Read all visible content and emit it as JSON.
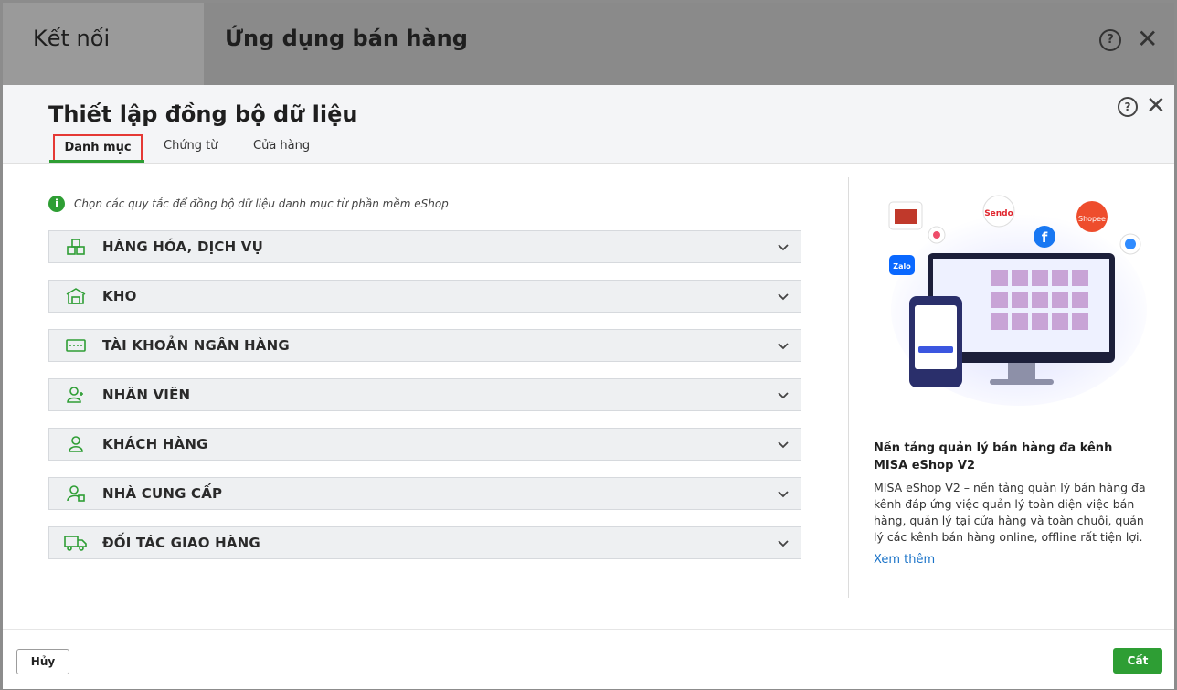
{
  "background": {
    "left_tab_label": "Kết nối",
    "title": "Ứng dụng bán hàng"
  },
  "dialog": {
    "title": "Thiết lập đồng bộ dữ liệu",
    "tabs": [
      {
        "label": "Danh mục",
        "active": true
      },
      {
        "label": "Chứng từ",
        "active": false
      },
      {
        "label": "Cửa hàng",
        "active": false
      }
    ],
    "info_text": "Chọn các quy tắc để đồng bộ dữ liệu danh mục từ phần mềm eShop",
    "sections": [
      {
        "label": "HÀNG HÓA, DỊCH VỤ",
        "icon": "boxes-icon"
      },
      {
        "label": "KHO",
        "icon": "warehouse-icon"
      },
      {
        "label": "TÀI KHOẢN NGÂN HÀNG",
        "icon": "bank-card-icon"
      },
      {
        "label": "NHÂN VIÊN",
        "icon": "employee-icon"
      },
      {
        "label": "KHÁCH HÀNG",
        "icon": "customer-icon"
      },
      {
        "label": "NHÀ CUNG CẤP",
        "icon": "supplier-icon"
      },
      {
        "label": "ĐỐI TÁC GIAO HÀNG",
        "icon": "delivery-truck-icon"
      }
    ],
    "promo": {
      "title": "Nền tảng quản lý bán hàng đa kênh MISA eShop V2",
      "description": "MISA eShop V2 – nền tảng quản lý bán hàng đa kênh đáp ứng việc quản lý toàn diện việc bán hàng, quản lý tại cửa hàng và toàn chuỗi, quản lý các kênh bán hàng online, offline rất tiện lợi.",
      "link_label": "Xem thêm",
      "image_labels": {
        "sendo": "Sendo",
        "shopee": "Shopee",
        "zalo": "Zalo"
      }
    },
    "footer": {
      "cancel_label": "Hủy",
      "save_label": "Cất"
    }
  },
  "colors": {
    "accent": "#2e9e34",
    "tab_highlight": "#e53935",
    "link": "#1a73c8"
  }
}
